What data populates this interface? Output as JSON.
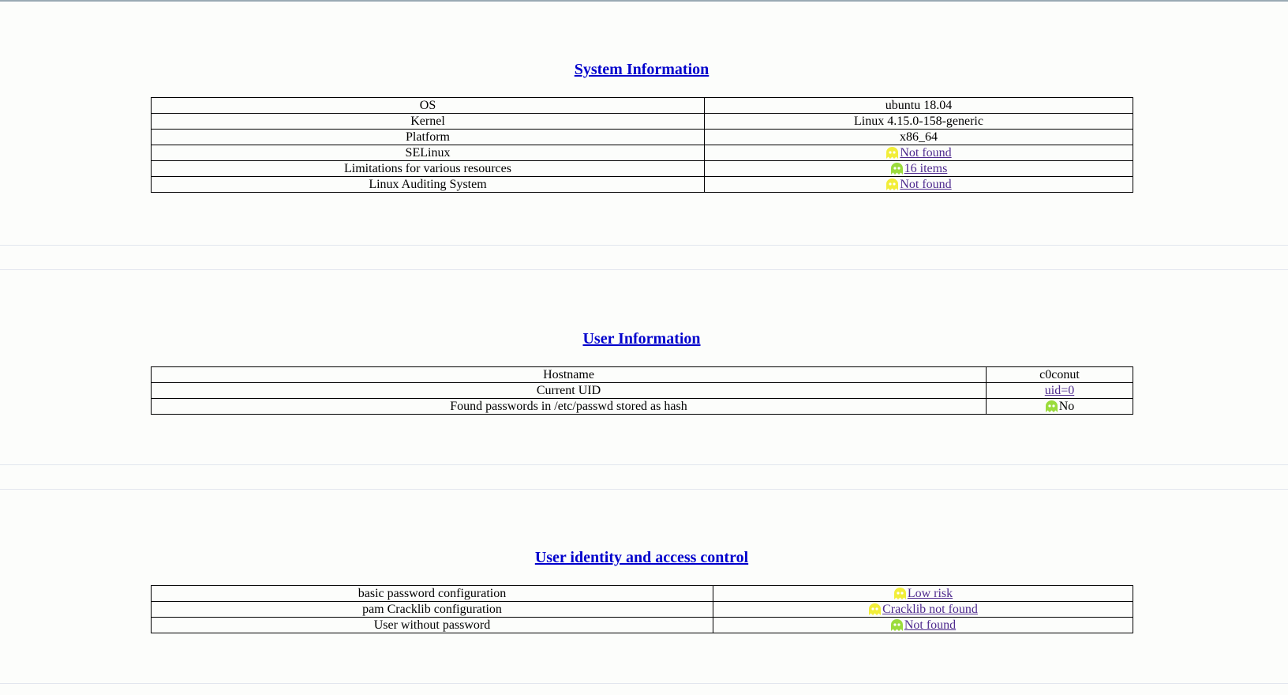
{
  "sections": {
    "system": {
      "title": "System Information",
      "rows": [
        {
          "label": "OS",
          "value": "ubuntu 18.04"
        },
        {
          "label": "Kernel",
          "value": "Linux 4.15.0-158-generic"
        },
        {
          "label": "Platform",
          "value": "x86_64"
        },
        {
          "label": "SELinux",
          "value": "Not found",
          "status": "yellow"
        },
        {
          "label": "Limitations for various resources",
          "value": "16 items",
          "status": "green"
        },
        {
          "label": "Linux Auditing System",
          "value": "Not found",
          "status": "yellow"
        }
      ]
    },
    "user": {
      "title": "User Information",
      "rows": [
        {
          "label": "Hostname",
          "value": "c0conut"
        },
        {
          "label": "Current UID",
          "value": "uid=0"
        },
        {
          "label": "Found passwords in /etc/passwd stored as hash",
          "value": "No",
          "status": "green"
        }
      ]
    },
    "identity": {
      "title": "User identity and access control",
      "rows": [
        {
          "label": "basic password configuration",
          "value": "Low risk",
          "status": "yellow"
        },
        {
          "label": "pam Cracklib configuration",
          "value": "Cracklib not found",
          "status": "yellow"
        },
        {
          "label": "User without password",
          "value": "Not found",
          "status": "green"
        }
      ]
    }
  },
  "colors": {
    "title_link": "#0000cc",
    "value_link": "#4e2a8e",
    "status_yellow": "#f2ee3a",
    "status_green": "#9bdc3c",
    "background": "#fcfdfb"
  },
  "icons": {
    "status": "ghost-icon"
  }
}
